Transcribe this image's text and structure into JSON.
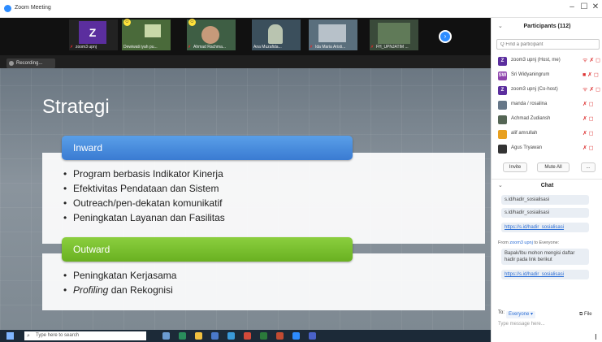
{
  "window": {
    "title": "Zoom Meeting",
    "minimize": "–",
    "maximize": "☐",
    "close": "✕"
  },
  "video_strip": {
    "tiles": [
      {
        "name": "zoom3 upnj",
        "initial": "Z",
        "bg": "#5b2e9e"
      },
      {
        "name": "Dewiwati iyah pu...",
        "bg": "#4a6a3a"
      },
      {
        "name": "Ahmad Rachma...",
        "bg": "#3e5e44"
      },
      {
        "name": "Ana Muzafida...",
        "bg": "#3b4f5c"
      },
      {
        "name": "Ida Maria Aristi...",
        "bg": "#5a6f7d"
      },
      {
        "name": "FH_UPNJATIM ...",
        "bg": "#3a4a3a"
      }
    ],
    "next_icon": "chevron-right-icon"
  },
  "recording": {
    "label": "Recording..."
  },
  "slide": {
    "title": "Strategi",
    "inward": {
      "heading": "Inward",
      "bullets": [
        "Program berbasis Indikator Kinerja",
        "Efektivitas Pendataan dan Sistem",
        "Outreach/pen-dekatan komunikatif",
        "Peningkatan Layanan dan Fasilitas"
      ]
    },
    "outward": {
      "heading": "Outward",
      "bullets": [
        "Peningkatan Kerjasama"
      ],
      "profiling_em": "Profiling",
      "profiling_rest": " dan Rekognisi"
    }
  },
  "taskbar": {
    "search_placeholder": "Type here to search"
  },
  "participants": {
    "title": "Participants (112)",
    "search_placeholder": "Q Find a participant",
    "items": [
      {
        "name": "zoom3 upnj (Host, me)",
        "initial": "Z",
        "color": "#5b2e9e",
        "icons": "ᯤ ✗ ◻"
      },
      {
        "name": "Sri Widyaningrum",
        "initial": "SW",
        "color": "#8e44ad",
        "icons": "■ ✗ ◻"
      },
      {
        "name": "zoom3 upnj (Co-host)",
        "initial": "Z",
        "color": "#5b2e9e",
        "icons": "ᯤ ✗ ◻"
      },
      {
        "name": "manda / rosalina",
        "initial": "",
        "color": "#667788",
        "icons": "✗ ◻"
      },
      {
        "name": "Achmad Zudiansh",
        "initial": "",
        "color": "#556655",
        "icons": "✗ ◻"
      },
      {
        "name": "alif amrullah",
        "initial": "",
        "color": "#e8a020",
        "icons": "✗ ◻"
      },
      {
        "name": "Agus Tryawan",
        "initial": "",
        "color": "#333333",
        "icons": "✗ ◻"
      }
    ],
    "invite_label": "Invite",
    "mute_all_label": "Mute All",
    "more_label": "..."
  },
  "chat": {
    "title": "Chat",
    "messages": [
      {
        "text": "s.id/hadir_sosialisasi",
        "link": false
      },
      {
        "text": "s.id/hadir_sosialisasi",
        "link": false
      },
      {
        "text": "https://s.id/hadir_sosialisasi",
        "link": true
      }
    ],
    "from_prefix": "From ",
    "from_sender": "zoom3 upnj",
    "from_suffix": " to Everyone:",
    "final_text": "Bapak/Ibu mohon mengisi daftar hadir pada link berikut",
    "final_link": "https://s.id/hadir_sosialisasi",
    "to_label": "To:",
    "to_value": "Everyone ▾",
    "file_label": "File",
    "type_placeholder": "Type message here..."
  }
}
